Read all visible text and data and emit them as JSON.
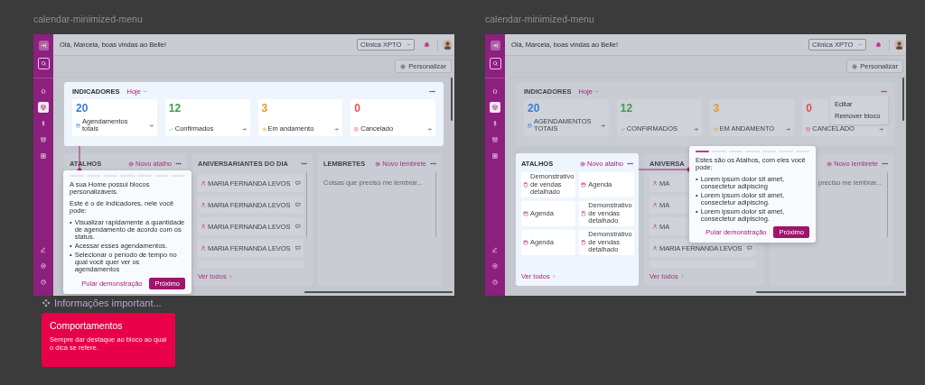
{
  "frames": [
    {
      "label": "calendar-minimized-menu",
      "greeting": "Olá, Marcela, boas vindas ao Belle!",
      "clinic": "Clínica XPTO",
      "customize": "Personalizar",
      "nav": [
        {
          "selected": false
        },
        {
          "selected": true
        },
        {
          "selected": false
        },
        {
          "selected": false
        },
        {
          "selected": false
        }
      ],
      "bottom_nav": [
        {
          "selected": false
        },
        {
          "selected": false
        },
        {
          "selected": false
        }
      ],
      "indicators": {
        "title": "INDICADORES",
        "period": "Hoje",
        "highlighted": true,
        "stats": [
          {
            "value": "20",
            "label": "Agendamentos totais",
            "color": "#3b7dd8"
          },
          {
            "value": "12",
            "label": "Confirmados",
            "color": "#3f9b4c"
          },
          {
            "value": "3",
            "label": "Em andamento",
            "color": "#e29a2a"
          },
          {
            "value": "0",
            "label": "Cancelado",
            "color": "#e0524f"
          }
        ]
      },
      "blocks": [
        {
          "kind": "shortcuts",
          "title": "ATALHOS",
          "action": "Novo atalho",
          "highlighted": false
        },
        {
          "kind": "birthdays",
          "title": "ANIVERSARIANTES DO DIA",
          "highlighted": false,
          "rows": [
            {
              "name": "MARIA FERNANDA LEVOS"
            },
            {
              "name": "MARIA FERNANDA LEVOS"
            },
            {
              "name": "MARIA FERNANDA LEVOS"
            },
            {
              "name": "MARIA FERNANDA LEVOS"
            }
          ],
          "link": "Ver todos"
        },
        {
          "kind": "reminders",
          "title": "LEMBRETES",
          "action": "Novo lembrete",
          "highlighted": false,
          "placeholder": "Coisas que preciso me lembrar..."
        }
      ],
      "tour": {
        "steps": [
          {
            "filled": false
          },
          {
            "filled": false
          },
          {
            "filled": false
          },
          {
            "filled": false
          },
          {
            "filled": false
          },
          {
            "filled": false
          },
          {
            "filled": false
          }
        ],
        "headings": [
          "A sua Home possui blocos personalizáveis.",
          "Este é o de Indicadores, nele você pode:"
        ],
        "marker": "•",
        "bullets": [
          "Visualizar rapidamente a quantidade de agendamento de acordo com os status.",
          "Acessar esses agendamentos.",
          "Selecionar o período de tempo no qual você quer ver os agendamentos"
        ],
        "skip": "Pular demonstração",
        "next": "Próximo"
      }
    },
    {
      "label": "calendar-minimized-menu",
      "greeting": "Olá, Marcela, boas vindas ao Belle!",
      "clinic": "Clínica XPTO",
      "customize": "Personalizar",
      "nav": [
        {
          "selected": false
        },
        {
          "selected": true
        },
        {
          "selected": false
        },
        {
          "selected": false
        },
        {
          "selected": false
        }
      ],
      "bottom_nav": [
        {
          "selected": false
        },
        {
          "selected": false
        },
        {
          "selected": false
        }
      ],
      "indicators": {
        "title": "INDICADORES",
        "period": "Hoje",
        "highlighted": false,
        "menu": [
          "Editar",
          "Remover bloco"
        ],
        "stats": [
          {
            "value": "20",
            "label": "AGENDAMENTOS TOTAIS",
            "color": "#3b7dd8"
          },
          {
            "value": "12",
            "label": "CONFIRMADOS",
            "color": "#3f9b4c"
          },
          {
            "value": "3",
            "label": "EM ANDAMENTO",
            "color": "#e29a2a"
          },
          {
            "value": "0",
            "label": "CANCELADO",
            "color": "#e0524f"
          }
        ]
      },
      "blocks": [
        {
          "kind": "shortcuts",
          "title": "ATALHOS",
          "action": "Novo atalho",
          "highlighted": true,
          "items": [
            {
              "label": "Demonstrativo de vendas detalhado",
              "kind": "report"
            },
            {
              "label": "Agenda",
              "kind": "calendar"
            },
            {
              "label": "Agenda",
              "kind": "calendar"
            },
            {
              "label": "Demonstrativo de vendas detalhado",
              "kind": "report"
            },
            {
              "label": "Agenda",
              "kind": "calendar"
            },
            {
              "label": "Demonstrativo de vendas detalhado",
              "kind": "report"
            }
          ],
          "link": "Ver todos"
        },
        {
          "kind": "birthdays",
          "title": "ANIVERSA",
          "highlighted": false,
          "rows": [
            {
              "name": "MA"
            },
            {
              "name": "MA"
            },
            {
              "name": "MA"
            },
            {
              "name": "MARIA FERNANDA LEVOS"
            }
          ],
          "link": "Ver todos"
        },
        {
          "kind": "reminders",
          "action": "Novo lembrete",
          "highlighted": false,
          "placeholder": "preciso me lembrar..."
        }
      ],
      "tour": {
        "steps": [
          {
            "filled": true
          },
          {
            "filled": false
          },
          {
            "filled": false
          },
          {
            "filled": false
          },
          {
            "filled": false
          },
          {
            "filled": false
          },
          {
            "filled": false
          }
        ],
        "headings": [
          "Estes são os Atalhos, com eles você pode:"
        ],
        "marker": "•",
        "bullets": [
          "Lorem ipsum dolor sit amet, consectetur adipiscing",
          "Lorem ipsum dolor sit amet, consectetur adipiscing.",
          "Lorem ipsum dolor sit amet, consectetur adipiscing."
        ],
        "skip": "Pular demonstração",
        "next": "Próximo"
      }
    }
  ],
  "note": {
    "header": "Informações important...",
    "title": "Comportamentos",
    "text": "Sempre dar destaque ao bloco ao qual o dica se refere."
  }
}
